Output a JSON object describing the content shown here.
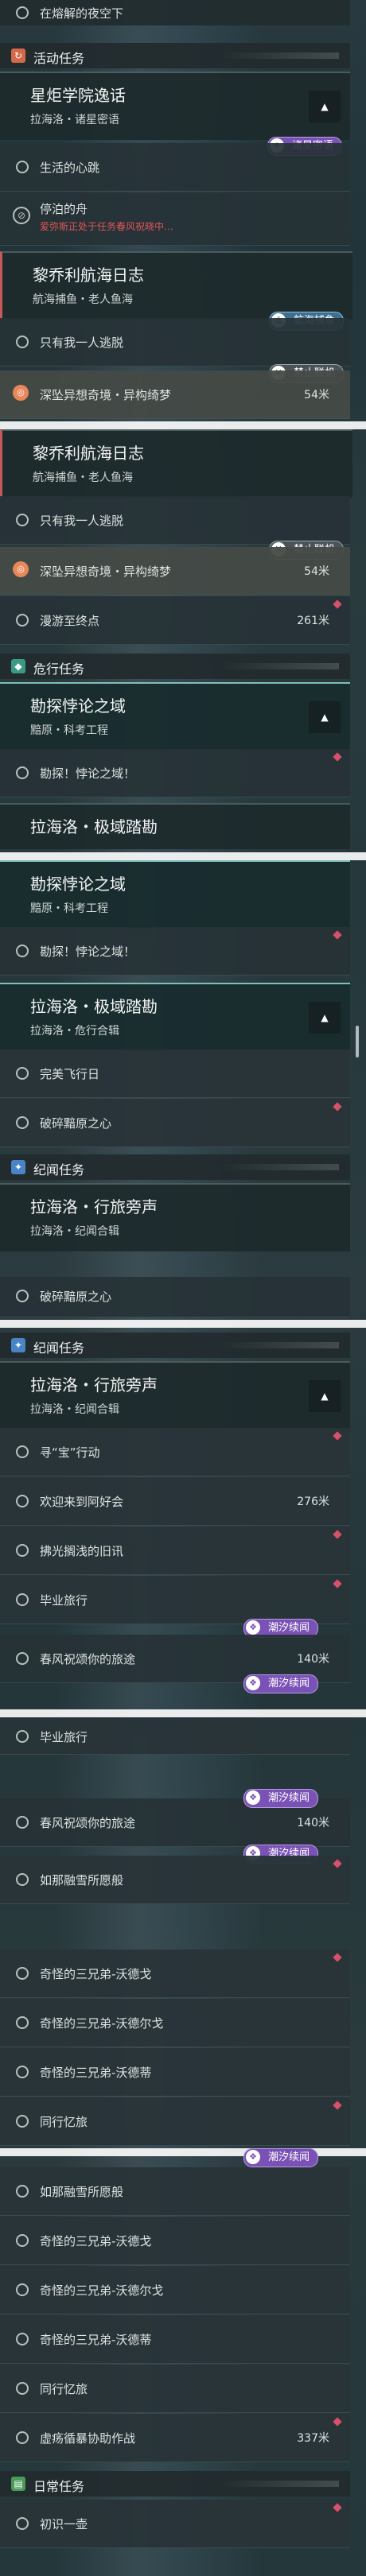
{
  "top_item": "在熔解的夜空下",
  "sections": {
    "activity": "活动任务",
    "danger": "危行任务",
    "chronicle": "纪闻任务",
    "daily": "日常任务"
  },
  "quests": {
    "academy": {
      "title": "星炬学院逸话",
      "sub": "拉海洛・诸星密语"
    },
    "lijo": {
      "title": "黎乔利航海日志",
      "sub": "航海捕鱼・老人鱼海"
    },
    "probe": {
      "title": "勘探悖论之域",
      "sub": "黯原・科考工程"
    },
    "explore": {
      "title": "拉海洛・极域踏勘",
      "sub": "拉海洛・危行合辑"
    },
    "travel": {
      "title": "拉海洛・行旅旁声",
      "sub": "拉海洛・纪闻合辑"
    }
  },
  "items": {
    "life_heart": "生活的心跳",
    "stranded_boat": "停泊的舟",
    "stranded_warning": "爱弥斯正处于任务春风祝晓中…",
    "only_me": "只有我一人逃脱",
    "dream": "深坠异想奇境・异构绮梦",
    "dream_dist": "54米",
    "wander_end": "漫游至终点",
    "wander_dist": "261米",
    "explore_paradox": "勘探！悖论之域！",
    "perfect_flight": "完美飞行日",
    "broken_heart": "破碎黯原之心",
    "seek_treasure": "寻“宝”行动",
    "welcome_tavern": "欢迎来到阿好会",
    "welcome_dist": "276米",
    "old_shipyard": "拂光搁浅的旧讯",
    "graduation": "毕业旅行",
    "spring_journey": "春风祝颂你的旅途",
    "spring_dist": "140米",
    "snow_drift": "如那融雪所愿般",
    "brother_gou": "奇怪的三兄弟-沃德戈",
    "brother_er": "奇怪的三兄弟-沃德尔戈",
    "brother_di": "奇怪的三兄弟-沃德蒂",
    "memory": "同行忆旅",
    "storm": "虚疡循暴协助作战",
    "storm_dist": "337米",
    "daily_first": "初识一壶"
  },
  "badges": {
    "stars": "诸星密语",
    "fishing": "航海捕鱼",
    "no_coop": "禁止联机",
    "tide": "潮汐续闻"
  },
  "colors": {
    "accent_red": "#d8506a",
    "badge_purple": "#7a52b6",
    "teal": "#7ec0b8"
  }
}
